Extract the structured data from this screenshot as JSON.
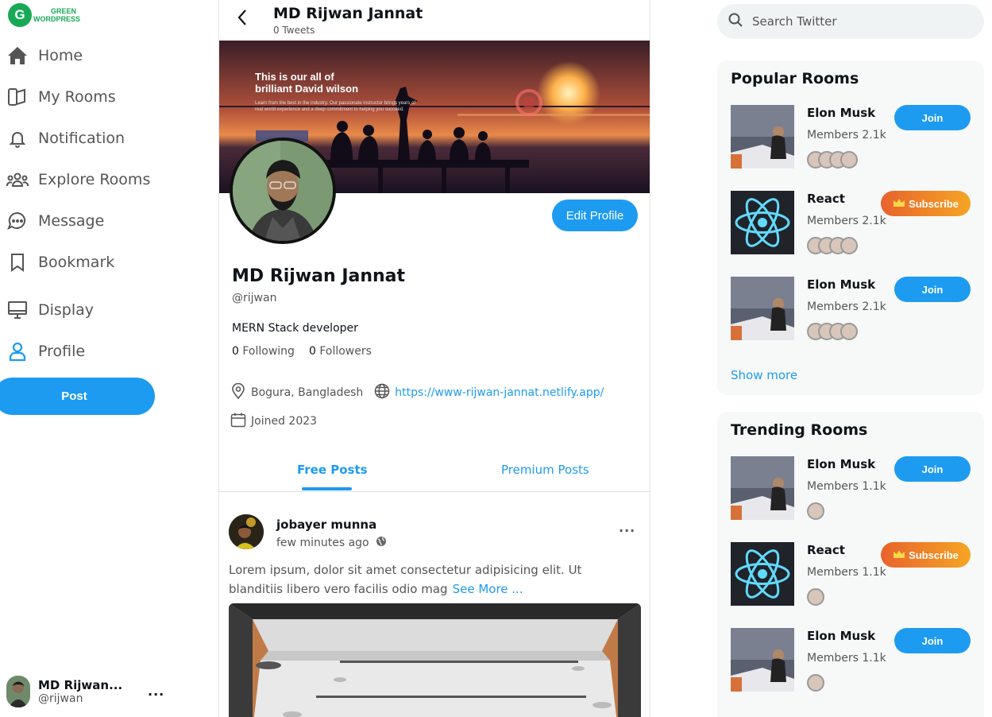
{
  "brand": {
    "line1": "GREEN",
    "line2": "WORDPRESS",
    "mark": "G"
  },
  "nav": [
    {
      "label": "Home",
      "icon": "home-icon"
    },
    {
      "label": "My Rooms",
      "icon": "rooms-icon"
    },
    {
      "label": "Notification",
      "icon": "bell-icon"
    },
    {
      "label": "Explore Rooms",
      "icon": "people-icon"
    },
    {
      "label": "Message",
      "icon": "chat-icon"
    },
    {
      "label": "Bookmark",
      "icon": "bookmark-icon"
    },
    {
      "label": "Display",
      "icon": "monitor-icon"
    },
    {
      "label": "Profile",
      "icon": "user-icon"
    }
  ],
  "post_button": "Post",
  "account": {
    "name": "MD Rijwan...",
    "handle": "@rijwan",
    "more": "..."
  },
  "header": {
    "name": "MD Rijwan Jannat",
    "tweets": "0 Tweets"
  },
  "cover": {
    "line1": "This is our all of",
    "line2": "brilliant David wilson",
    "body": "Learn from the best in the industry. Our passionate instructor brings years of real world experience and a deep commitment to helping you succeed."
  },
  "profile": {
    "edit_label": "Edit Profile",
    "name": "MD Rijwan Jannat",
    "handle": "@rijwan",
    "bio": "MERN Stack developer",
    "following_count": "0",
    "following_label": "Following",
    "followers_count": "0",
    "followers_label": "Followers",
    "location": "Bogura, Bangladesh",
    "website": "https://www-rijwan-jannat.netlify.app/",
    "joined": "Joined 2023"
  },
  "tabs": {
    "free": "Free Posts",
    "premium": "Premium Posts"
  },
  "post": {
    "author": "jobayer munna",
    "time": "few minutes ago",
    "more": "...",
    "text": "Lorem ipsum, dolor sit amet consectetur adipisicing elit. Ut blanditiis libero vero facilis odio mag",
    "see_more": "See More ..."
  },
  "search": {
    "placeholder": "Search Twitter"
  },
  "popular": {
    "title": "Popular Rooms",
    "rooms": [
      {
        "name": "Elon Musk",
        "members": "Members 2.1k",
        "action": "Join"
      },
      {
        "name": "React",
        "members": "Members 2.1k",
        "action": "Subscribe"
      },
      {
        "name": "Elon Musk",
        "members": "Members 2.1k",
        "action": "Join"
      }
    ],
    "show_more": "Show more"
  },
  "trending": {
    "title": "Trending Rooms",
    "rooms": [
      {
        "name": "Elon Musk",
        "members": "Members 1.1k",
        "action": "Join"
      },
      {
        "name": "React",
        "members": "Members 1.1k",
        "action": "Subscribe"
      },
      {
        "name": "Elon Musk",
        "members": "Members 1.1k",
        "action": "Join"
      }
    ]
  },
  "colors": {
    "accent": "#1d9bf0",
    "brand": "#18a957",
    "subscribe_start": "#e8632c",
    "subscribe_end": "#f5a524"
  }
}
